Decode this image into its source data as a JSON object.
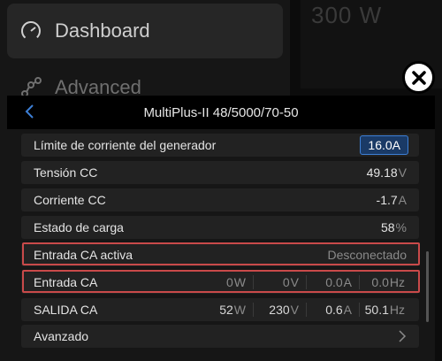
{
  "nav": {
    "items": [
      {
        "label": "Dashboard",
        "icon": "gauge-icon",
        "active": true
      },
      {
        "label": "Advanced",
        "icon": "graph-nodes-icon",
        "active": false
      }
    ]
  },
  "background": {
    "power_value": "300 W"
  },
  "dialog": {
    "title": "MultiPlus-II 48/5000/70-50",
    "rows": {
      "gen_limit": {
        "label": "Límite de corriente del generador",
        "value": "16.0A"
      },
      "dc_voltage": {
        "label": "Tensión CC",
        "value": "49.18",
        "unit": "V"
      },
      "dc_current": {
        "label": "Corriente CC",
        "value": "-1.7",
        "unit": "A"
      },
      "soc": {
        "label": "Estado de carga",
        "value": "58",
        "unit": "%"
      },
      "active_input": {
        "label": "Entrada CA activa",
        "value": "Desconectado"
      },
      "ac_input": {
        "label": "Entrada CA",
        "power": "0",
        "power_unit": "W",
        "voltage": "0",
        "voltage_unit": "V",
        "current": "0.0",
        "current_unit": "A",
        "freq": "0.0",
        "freq_unit": "Hz"
      },
      "ac_output": {
        "label": "SALIDA CA",
        "power": "52",
        "power_unit": "W",
        "voltage": "230",
        "voltage_unit": "V",
        "current": "0.6",
        "current_unit": "A",
        "freq": "50.1",
        "freq_unit": "Hz"
      },
      "advanced": {
        "label": "Avanzado"
      }
    }
  },
  "colors": {
    "highlight": "#c94a4a",
    "accent": "#3d7fd6"
  }
}
